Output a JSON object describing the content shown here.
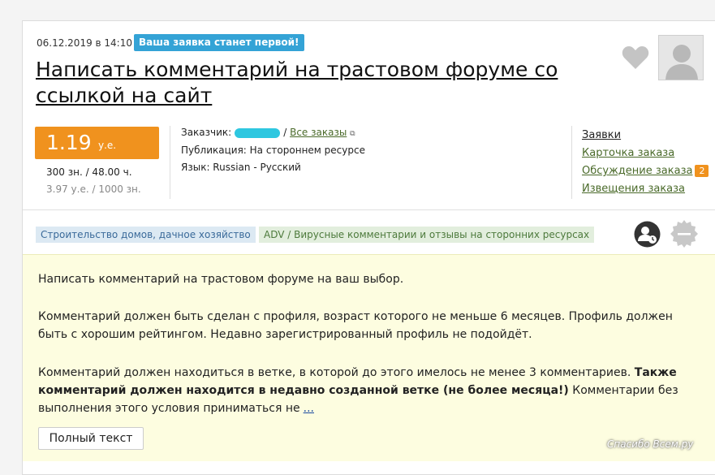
{
  "order": {
    "date": "06.12.2019 в 14:10",
    "badge": "Ваша заявка станет первой!",
    "title": "Написать комментарий на трастовом форуме со ссылкой на сайт"
  },
  "price": {
    "value": "1.19",
    "currency": "у.е.",
    "stats_line1": "300 зн.  /  48.00 ч.",
    "stats_line2": "3.97 у.е.  /  1000 зн."
  },
  "meta": {
    "customer_label": "Заказчик:",
    "separator": "/",
    "all_orders": "Все заказы",
    "publication": "Публикация:  На стороннем ресурсе",
    "language": "Язык: Russian - Русский"
  },
  "links": {
    "applications": "Заявки",
    "order_card": "Карточка заказа",
    "discussion": "Обсуждение заказа",
    "discussion_count": "2",
    "notifications": "Извещения заказа"
  },
  "tags": [
    "Строительство домов, дачное хозяйство",
    "ADV / Вирусные комментарии и отзывы на сторонних ресурсах"
  ],
  "description": {
    "p1": "Написать комментарий на трастовом форуме на ваш выбор.",
    "p2": "Комментарий должен быть сделан с профиля, возраст которого не меньше 6 месяцев. Профиль должен быть с хорошим рейтингом. Недавно зарегистрированный профиль не подойдёт.",
    "p3_start": "Комментарий должен находиться в ветке, в которой до этого имелось не менее 3 комментариев. ",
    "p3_bold": "Также комментарий должен находится в недавно созданной ветке (не более месяца!)",
    "p3_end": " Комментарии без выполнения этого условия приниматься не",
    "more": "...",
    "full_text_button": "Полный текст"
  },
  "watermark": "Спасибо Всем.ру",
  "colors": {
    "badge": "#34a3d6",
    "price": "#f0921e",
    "desc_bg": "#fdfde0"
  }
}
